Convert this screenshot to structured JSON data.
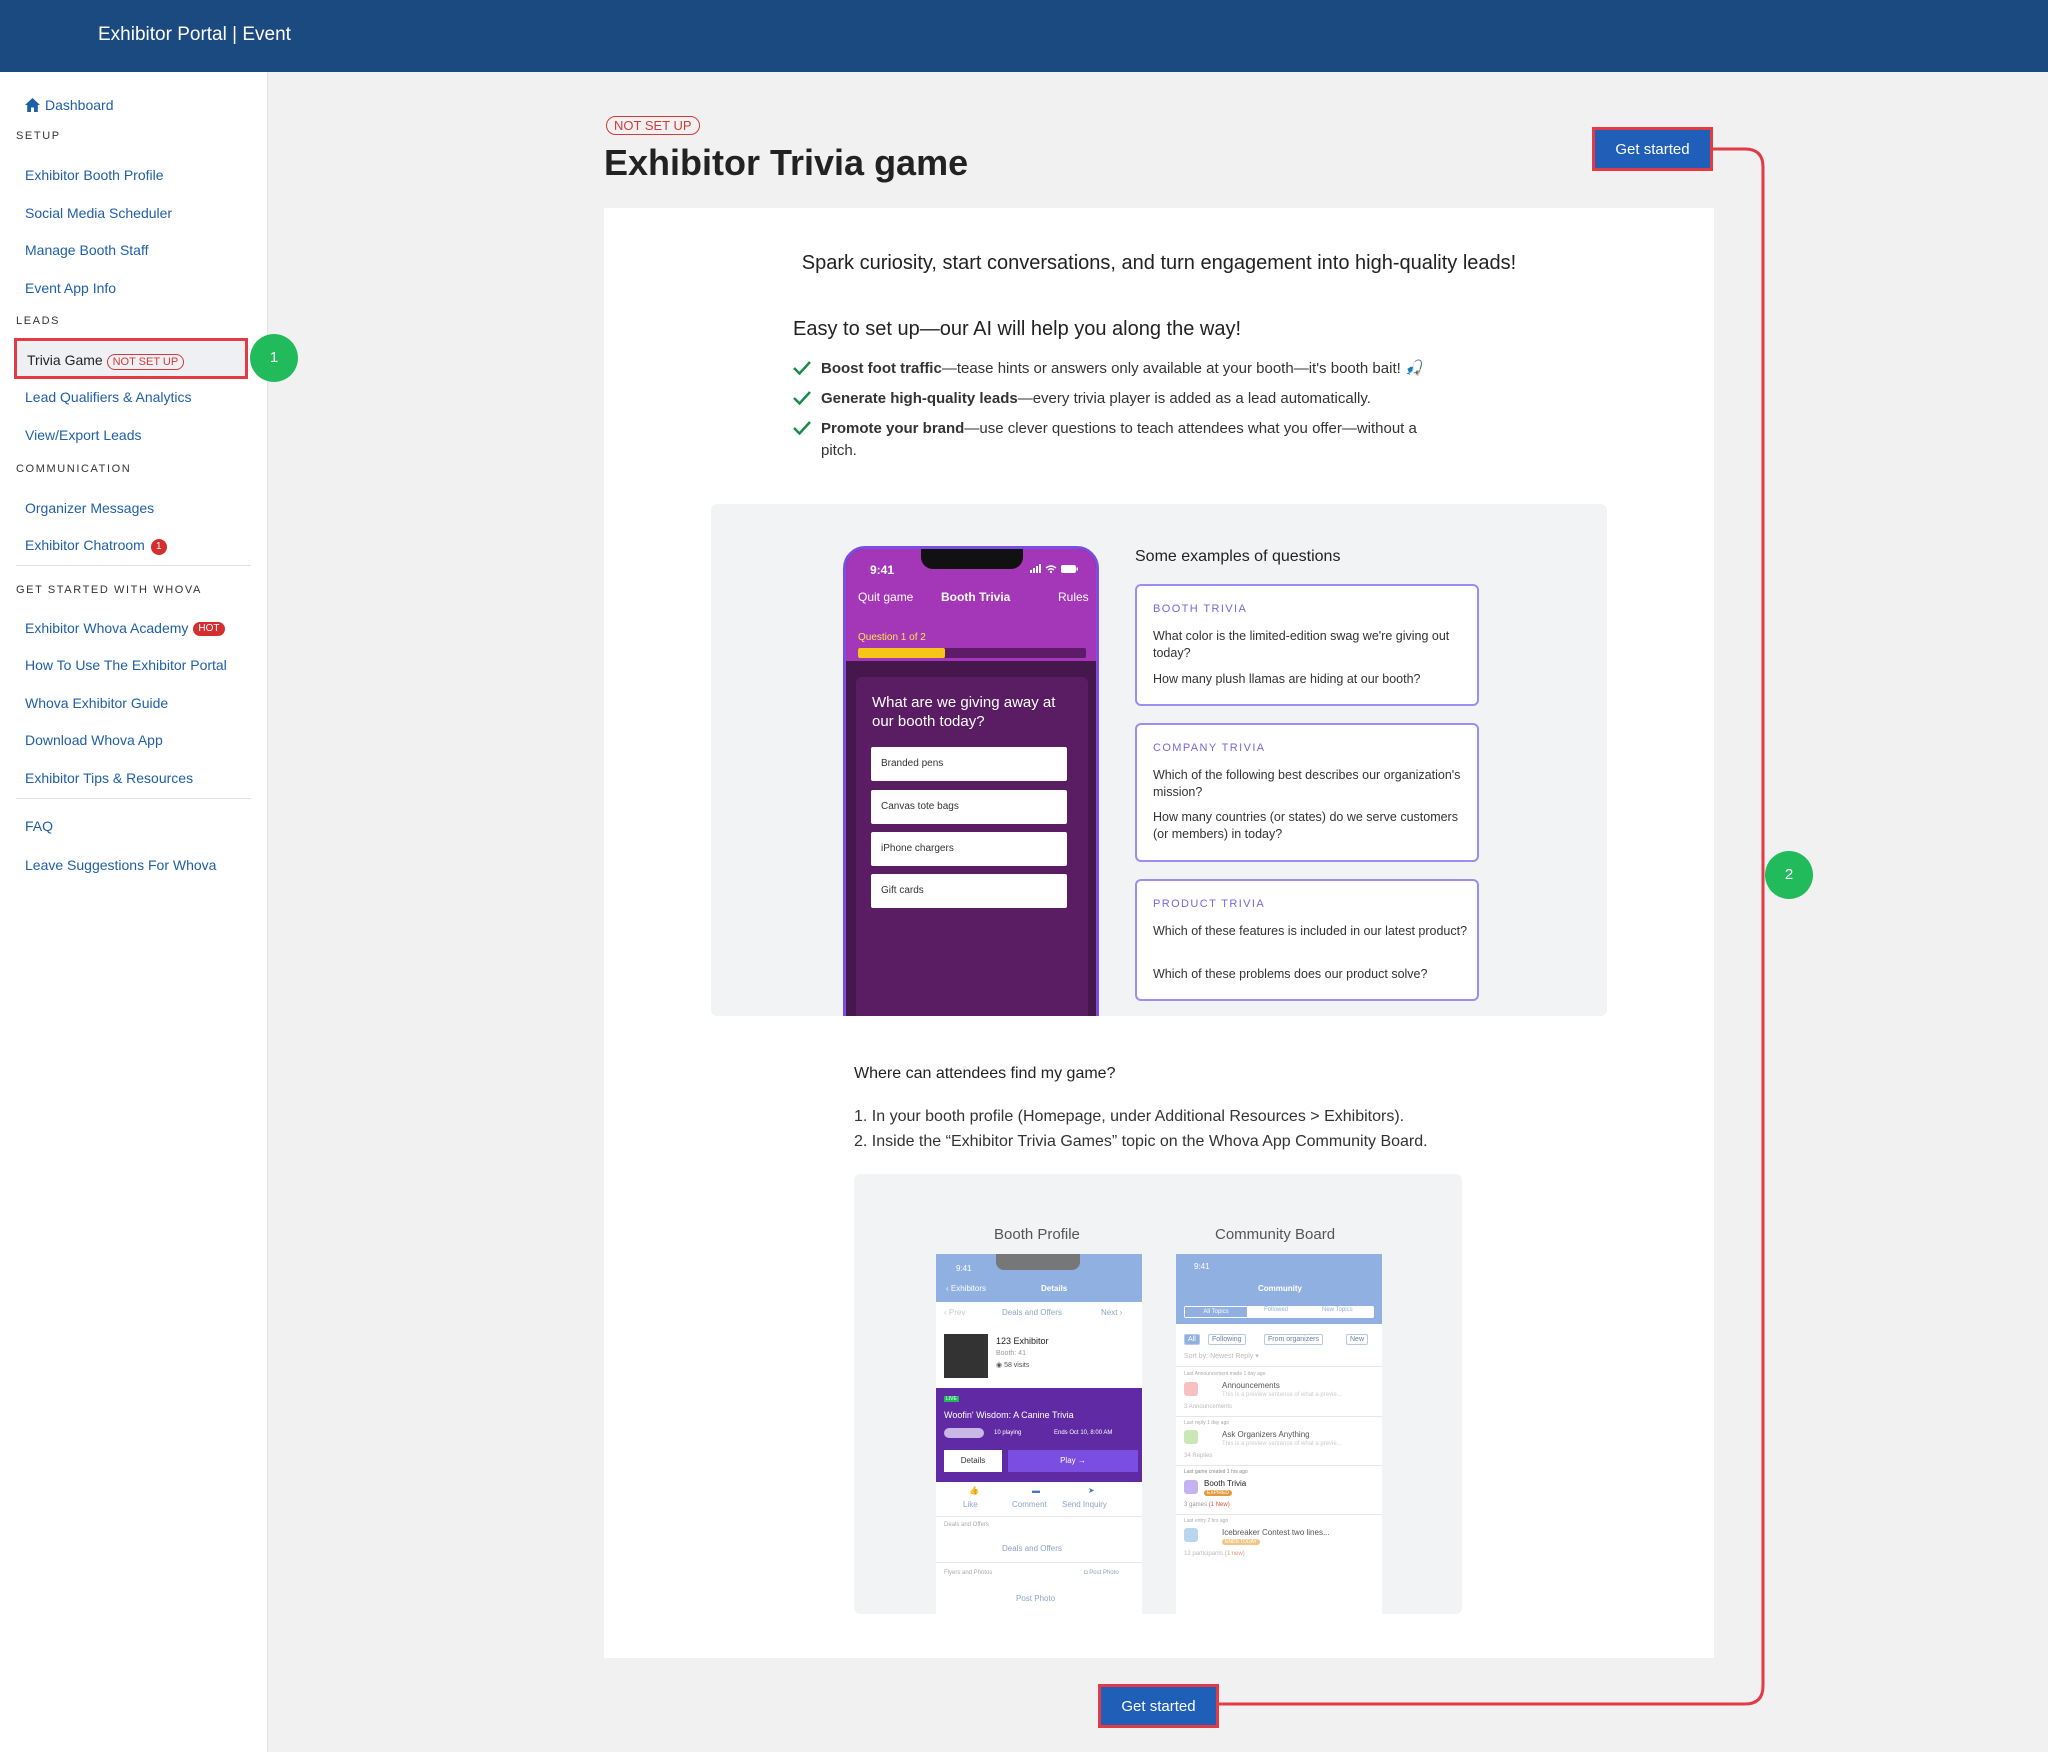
{
  "topbar": {
    "title": "Exhibitor Portal | Event"
  },
  "sidebar": {
    "dashboard": "Dashboard",
    "sections": {
      "setup": "SETUP",
      "leads": "LEADS",
      "communication": "COMMUNICATION",
      "get_started": "GET STARTED WITH WHOVA"
    },
    "setup_items": [
      "Exhibitor Booth Profile",
      "Social Media Scheduler",
      "Manage Booth Staff",
      "Event App Info"
    ],
    "trivia_item": {
      "label": "Trivia Game",
      "badge": "NOT SET UP"
    },
    "leads_items": [
      "Lead Qualifiers & Analytics",
      "View/Export Leads"
    ],
    "communication_items": {
      "organizer_messages": "Organizer Messages",
      "chatroom": "Exhibitor Chatroom",
      "chatroom_count": "1"
    },
    "whova_items": {
      "academy": "Exhibitor Whova Academy",
      "academy_badge": "HOT",
      "how_to": "How To Use The Exhibitor Portal",
      "guide": "Whova Exhibitor Guide",
      "download": "Download Whova App",
      "tips": "Exhibitor Tips & Resources"
    },
    "faq": "FAQ",
    "suggestions": "Leave Suggestions For Whova"
  },
  "steps": {
    "one": "1",
    "two": "2"
  },
  "header": {
    "status": "NOT SET UP",
    "title": "Exhibitor Trivia game",
    "get_started": "Get started"
  },
  "content": {
    "intro": "Spark curiosity, start conversations, and turn engagement into high-quality leads!",
    "easy": "Easy to set up—our AI will help you along the way!",
    "bullets": [
      {
        "bold": "Boost foot traffic",
        "text": "—tease hints or answers only available at your booth—it's booth bait! 🎣"
      },
      {
        "bold": "Generate high-quality leads",
        "text": "—every trivia player is added as a lead automatically."
      },
      {
        "bold": "Promote your brand",
        "text": "—use clever questions to teach attendees what you offer—without a pitch."
      }
    ],
    "phone": {
      "time": "9:41",
      "quit": "Quit game",
      "name": "Booth Trivia",
      "rules": "Rules",
      "progress_label": "Question 1 of 2",
      "progress": 0.38,
      "question": "What are we giving away at our booth today?",
      "options": [
        "Branded pens",
        "Canvas tote bags",
        "iPhone chargers",
        "Gift cards"
      ]
    },
    "examples_heading": "Some examples of questions",
    "examples": [
      {
        "tag": "BOOTH TRIVIA",
        "q1": "What color is the limited-edition swag we're giving out today?",
        "q2": "How many plush llamas are hiding at our booth?"
      },
      {
        "tag": "COMPANY TRIVIA",
        "q1": "Which of the following best describes our organization's mission?",
        "q2": "How many countries (or states) do we serve customers (or members) in today?"
      },
      {
        "tag": "PRODUCT TRIVIA",
        "q1": "Which of these features is included in our latest product?",
        "q2": "Which of these problems does our product solve?"
      }
    ],
    "where_title": "Where can attendees find my game?",
    "where_1": "1. In your booth profile (Homepage, under Additional Resources > Exhibitors).",
    "where_2": "2. Inside the “Exhibitor Trivia Games” topic on the Whova App Community Board.",
    "booth_label": "Booth Profile",
    "community_label": "Community Board",
    "booth_screen": {
      "time": "9:41",
      "back": "Exhibitors",
      "details": "Details",
      "prev": "Prev",
      "deals_tab": "Deals and Offers",
      "next": "Next",
      "exhibitor": "123 Exhibitor",
      "booth": "Booth: 41",
      "visits": "58 visits",
      "live": "LIVE",
      "game": "Woofin' Wisdom: A Canine Trivia",
      "playing": "10 playing",
      "ends": "Ends Oct 10, 8:00 AM",
      "details_btn": "Details",
      "play_btn": "Play →",
      "like": "Like",
      "comment": "Comment",
      "inquiry": "Send Inquiry",
      "deals_section": "Deals and Offers",
      "deals_link": "Deals and Offers",
      "flyers": "Flyers and Photos",
      "post_photo_small": "Post Photo",
      "post_photo": "Post Photo"
    },
    "community_screen": {
      "time": "9:41",
      "title": "Community",
      "tabs": [
        "All Topics",
        "Followed",
        "New Topics"
      ],
      "filters": [
        "All",
        "Following",
        "From organizers",
        "New"
      ],
      "sort": "Sort by: Newest Reply ▾",
      "t1_meta": "Last Announcement made 1 day ago",
      "t1": "Announcements",
      "t1_sub": "This is a preview sentence of what a previe...",
      "t1_count": "3 Announcements",
      "t2_meta": "Last reply 1 day ago",
      "t2": "Ask Organizers Anything",
      "t2_sub": "This is a preview sentence of what a previe...",
      "t2_count": "34 Replies",
      "t3_meta": "Last game created 1 hrs ago",
      "t3": "Booth Trivia",
      "t3_badge": "EXPIRED",
      "t3_count": "3 games",
      "t3_new": "(1 New)",
      "t4_meta": "Last entry 2 hrs ago",
      "t4": "Icebreaker Contest two lines...",
      "t4_badge": "ENDS TODAY",
      "t4_count": "12 participants",
      "t4_new": "(1 new)"
    }
  },
  "colors": {
    "topbar": "#1a4a80",
    "primary_button": "#1f5fb8",
    "highlight": "#e23b45",
    "step": "#22bb5b",
    "link": "#1f5fa8"
  }
}
